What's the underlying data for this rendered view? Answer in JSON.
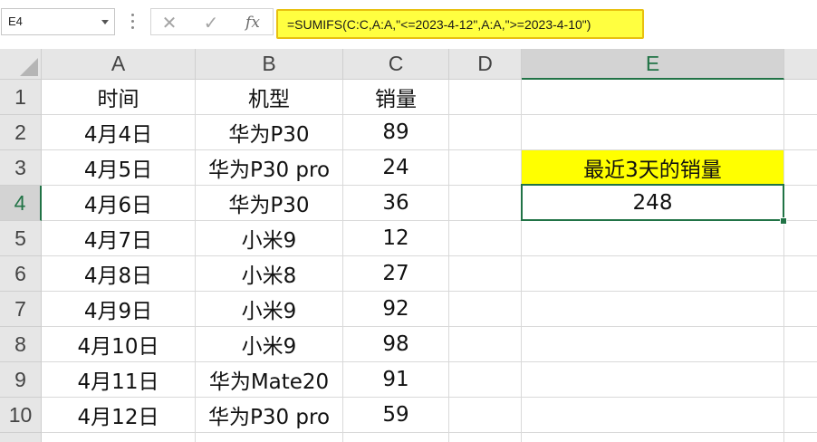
{
  "name_box": {
    "value": "E4"
  },
  "formula_bar": {
    "cancel_glyph": "✕",
    "enter_glyph": "✓",
    "fx_label": "fx",
    "formula": "=SUMIFS(C:C,A:A,\"<=2023-4-12\",A:A,\">=2023-4-10\")",
    "highlight_color": "#ffff40"
  },
  "columns": [
    "A",
    "B",
    "C",
    "D",
    "E"
  ],
  "rows": [
    "1",
    "2",
    "3",
    "4",
    "5",
    "6",
    "7",
    "8",
    "9",
    "10"
  ],
  "active_cell": {
    "column": "E",
    "row": "4"
  },
  "table": {
    "headers": {
      "date": "时间",
      "model": "机型",
      "sales": "销量"
    },
    "records": [
      {
        "date": "4月4日",
        "model": "华为P30",
        "sales": "89"
      },
      {
        "date": "4月5日",
        "model": "华为P30 pro",
        "sales": "24"
      },
      {
        "date": "4月6日",
        "model": "华为P30",
        "sales": "36"
      },
      {
        "date": "4月7日",
        "model": "小米9",
        "sales": "12"
      },
      {
        "date": "4月8日",
        "model": "小米8",
        "sales": "27"
      },
      {
        "date": "4月9日",
        "model": "小米9",
        "sales": "92"
      },
      {
        "date": "4月10日",
        "model": "小米9",
        "sales": "98"
      },
      {
        "date": "4月11日",
        "model": "华为Mate20",
        "sales": "91"
      },
      {
        "date": "4月12日",
        "model": "华为P30 pro",
        "sales": "59"
      }
    ]
  },
  "summary": {
    "label": "最近3天的销量",
    "value": "248",
    "label_fill": "#ffff00"
  },
  "accent_color": "#217346"
}
